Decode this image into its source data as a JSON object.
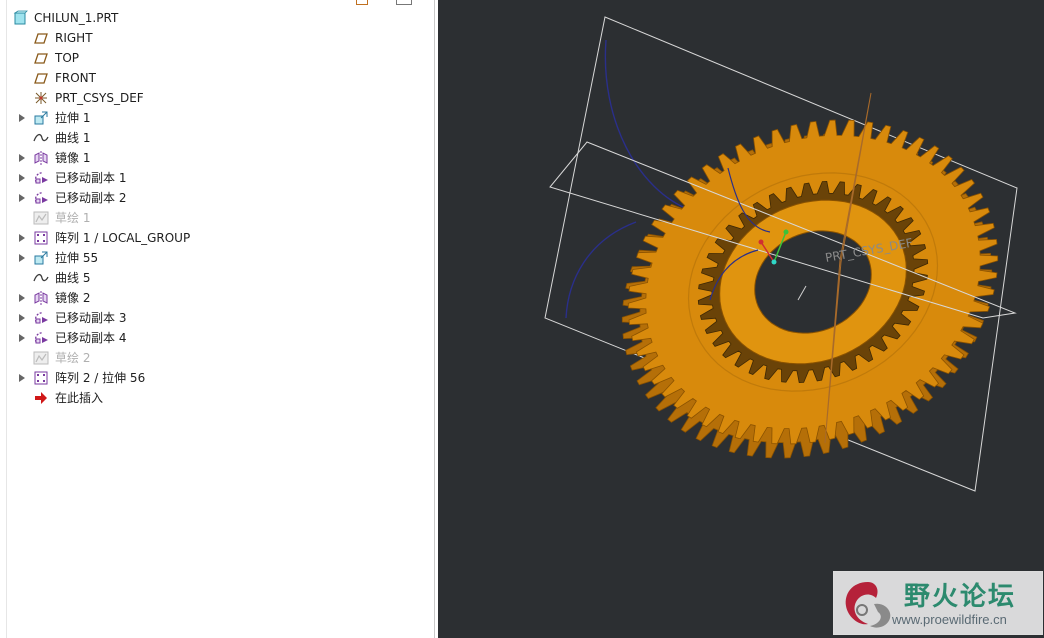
{
  "tree": {
    "root": {
      "label": "CHILUN_1.PRT",
      "icon": "part-icon"
    },
    "items": [
      {
        "label": "RIGHT",
        "icon": "datum-plane-icon",
        "expandable": false,
        "suppressed": false
      },
      {
        "label": "TOP",
        "icon": "datum-plane-icon",
        "expandable": false,
        "suppressed": false
      },
      {
        "label": "FRONT",
        "icon": "datum-plane-icon",
        "expandable": false,
        "suppressed": false
      },
      {
        "label": "PRT_CSYS_DEF",
        "icon": "coordinate-system-icon",
        "expandable": false,
        "suppressed": false
      },
      {
        "label": "拉伸 1",
        "icon": "extrude-icon",
        "expandable": true,
        "suppressed": false
      },
      {
        "label": "曲线 1",
        "icon": "curve-icon",
        "expandable": false,
        "suppressed": false
      },
      {
        "label": "镜像 1",
        "icon": "mirror-icon",
        "expandable": true,
        "suppressed": false
      },
      {
        "label": "已移动副本 1",
        "icon": "moved-copy-icon",
        "expandable": true,
        "suppressed": false
      },
      {
        "label": "已移动副本 2",
        "icon": "moved-copy-icon",
        "expandable": true,
        "suppressed": false
      },
      {
        "label": "草绘 1",
        "icon": "sketch-icon",
        "expandable": false,
        "suppressed": true
      },
      {
        "label": "阵列 1 / LOCAL_GROUP",
        "icon": "pattern-icon",
        "expandable": true,
        "suppressed": false
      },
      {
        "label": "拉伸 55",
        "icon": "extrude-icon",
        "expandable": true,
        "suppressed": false
      },
      {
        "label": "曲线 5",
        "icon": "curve-icon",
        "expandable": false,
        "suppressed": false
      },
      {
        "label": "镜像 2",
        "icon": "mirror-icon",
        "expandable": true,
        "suppressed": false
      },
      {
        "label": "已移动副本 3",
        "icon": "moved-copy-icon",
        "expandable": true,
        "suppressed": false
      },
      {
        "label": "已移动副本 4",
        "icon": "moved-copy-icon",
        "expandable": true,
        "suppressed": false
      },
      {
        "label": "草绘 2",
        "icon": "sketch-icon",
        "expandable": false,
        "suppressed": true
      },
      {
        "label": "阵列 2 / 拉伸 56",
        "icon": "pattern-icon",
        "expandable": true,
        "suppressed": false
      },
      {
        "label": "在此插入",
        "icon": "insert-here-arrow-icon",
        "expandable": false,
        "suppressed": false
      }
    ]
  },
  "viewport": {
    "csys_label": "PRT_CSYS_DEF",
    "background_color": "#2c2f32",
    "gear_color": "#d88a0c",
    "gear_edge_color": "#8a5200",
    "plane_color": "#d8d8d8",
    "curve_color": "#2a2f8a"
  },
  "watermark": {
    "title": "野火论坛",
    "url": "www.proewildfire.cn"
  }
}
